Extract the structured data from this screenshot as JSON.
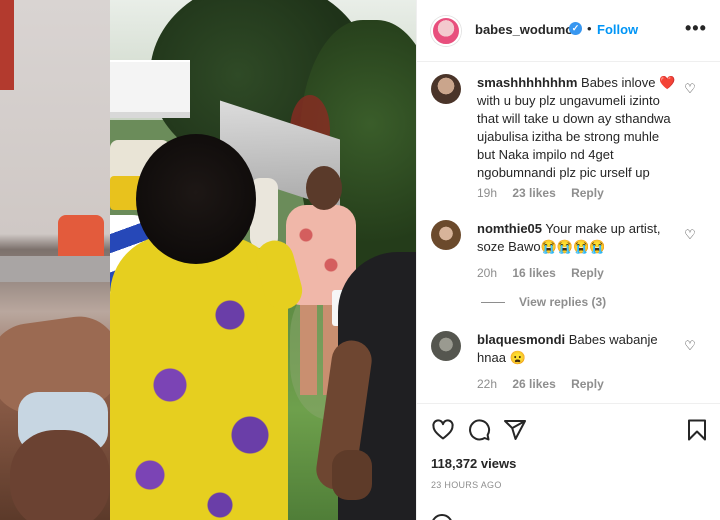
{
  "header": {
    "username": "babes_wodumo",
    "separator": "•",
    "follow_label": "Follow",
    "more_label": "•••"
  },
  "comments": [
    {
      "username": "smashhhhhhhm",
      "text": "Babes inlove ❤️ with u buy plz ungavumeli izinto that will take u down ay sthandwa ujabulisa izitha be strong muhle but Naka impilo nd 4get ngobumnandi plz pic urself up",
      "time": "19h",
      "likes": "23 likes",
      "reply_label": "Reply"
    },
    {
      "username": "nomthie05",
      "text": "Your make up artist, soze Bawo😭😭😭😭",
      "time": "20h",
      "likes": "16 likes",
      "reply_label": "Reply",
      "view_replies": "View replies (3)"
    },
    {
      "username": "blaquesmondi",
      "text": "Babes wabanje hnaa 😦",
      "time": "22h",
      "likes": "26 likes",
      "reply_label": "Reply"
    }
  ],
  "post": {
    "views": "118,372 views",
    "time_ago": "23 HOURS AGO"
  },
  "icons": {
    "like": "heart-icon",
    "comment": "comment-icon",
    "share": "share-icon",
    "save": "bookmark-icon"
  },
  "colors": {
    "accent": "#0095f6",
    "text": "#262626",
    "muted": "#8e8e8e",
    "verified": "#3897f0"
  }
}
